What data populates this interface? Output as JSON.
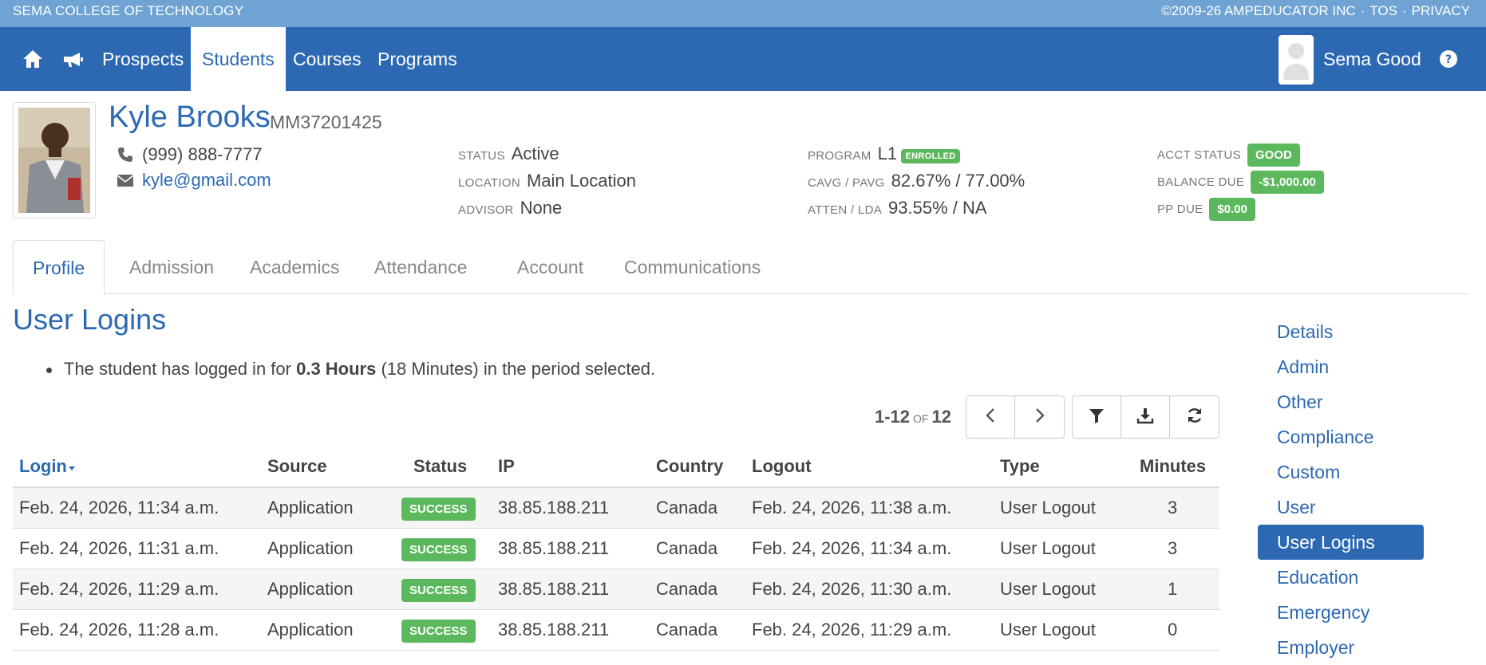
{
  "topbar": {
    "school_name": "SEMA COLLEGE OF TECHNOLOGY",
    "copyright": "©2009-26 AMPEDUCATOR INC",
    "tos": "TOS",
    "privacy": "PRIVACY"
  },
  "navbar": {
    "items": [
      {
        "label": "Prospects"
      },
      {
        "label": "Students"
      },
      {
        "label": "Courses"
      },
      {
        "label": "Programs"
      }
    ],
    "active": "Students",
    "user_name": "Sema Good"
  },
  "student": {
    "name": "Kyle Brooks",
    "id": "MM37201425",
    "phone": "(999) 888-7777",
    "email": "kyle@gmail.com",
    "status_label": "STATUS",
    "status": "Active",
    "location_label": "LOCATION",
    "location": "Main Location",
    "advisor_label": "ADVISOR",
    "advisor": "None",
    "program_label": "PROGRAM",
    "program": "L1",
    "program_badge": "ENROLLED",
    "cavg_label": "CAVG / PAVG",
    "cavg": "82.67% / 77.00%",
    "atten_label": "ATTEN / LDA",
    "atten": "93.55% / NA",
    "acct_label": "ACCT STATUS",
    "acct_status": "GOOD",
    "balance_label": "BALANCE DUE",
    "balance": "-$1,000.00",
    "pp_label": "PP DUE",
    "pp_due": "$0.00"
  },
  "tabs": [
    {
      "label": "Profile"
    },
    {
      "label": "Admission"
    },
    {
      "label": "Academics"
    },
    {
      "label": "Attendance"
    },
    {
      "label": "Account"
    },
    {
      "label": "Communications"
    }
  ],
  "section": {
    "title": "User Logins",
    "summary_pre": "The student has logged in for ",
    "summary_bold": "0.3 Hours",
    "summary_post": " (18 Minutes) in the period selected."
  },
  "pager": {
    "range": "1-12",
    "of": "of",
    "total": "12"
  },
  "table": {
    "headers": {
      "login": "Login",
      "source": "Source",
      "status": "Status",
      "ip": "IP",
      "country": "Country",
      "logout": "Logout",
      "type": "Type",
      "minutes": "Minutes"
    },
    "rows": [
      {
        "login": "Feb. 24, 2026, 11:34 a.m.",
        "source": "Application",
        "status": "SUCCESS",
        "ip": "38.85.188.211",
        "country": "Canada",
        "logout": "Feb. 24, 2026, 11:38 a.m.",
        "type": "User Logout",
        "minutes": "3"
      },
      {
        "login": "Feb. 24, 2026, 11:31 a.m.",
        "source": "Application",
        "status": "SUCCESS",
        "ip": "38.85.188.211",
        "country": "Canada",
        "logout": "Feb. 24, 2026, 11:34 a.m.",
        "type": "User Logout",
        "minutes": "3"
      },
      {
        "login": "Feb. 24, 2026, 11:29 a.m.",
        "source": "Application",
        "status": "SUCCESS",
        "ip": "38.85.188.211",
        "country": "Canada",
        "logout": "Feb. 24, 2026, 11:30 a.m.",
        "type": "User Logout",
        "minutes": "1"
      },
      {
        "login": "Feb. 24, 2026, 11:28 a.m.",
        "source": "Application",
        "status": "SUCCESS",
        "ip": "38.85.188.211",
        "country": "Canada",
        "logout": "Feb. 24, 2026, 11:29 a.m.",
        "type": "User Logout",
        "minutes": "0"
      }
    ]
  },
  "side_nav": {
    "items": [
      "Details",
      "Admin",
      "Other",
      "Compliance",
      "Custom",
      "User",
      "User Logins",
      "Education",
      "Emergency",
      "Employer"
    ],
    "active": "User Logins"
  },
  "colors": {
    "brand_blue": "#2d69b3",
    "topbar_blue": "#6fa3d3",
    "success_green": "#5cb85c"
  }
}
